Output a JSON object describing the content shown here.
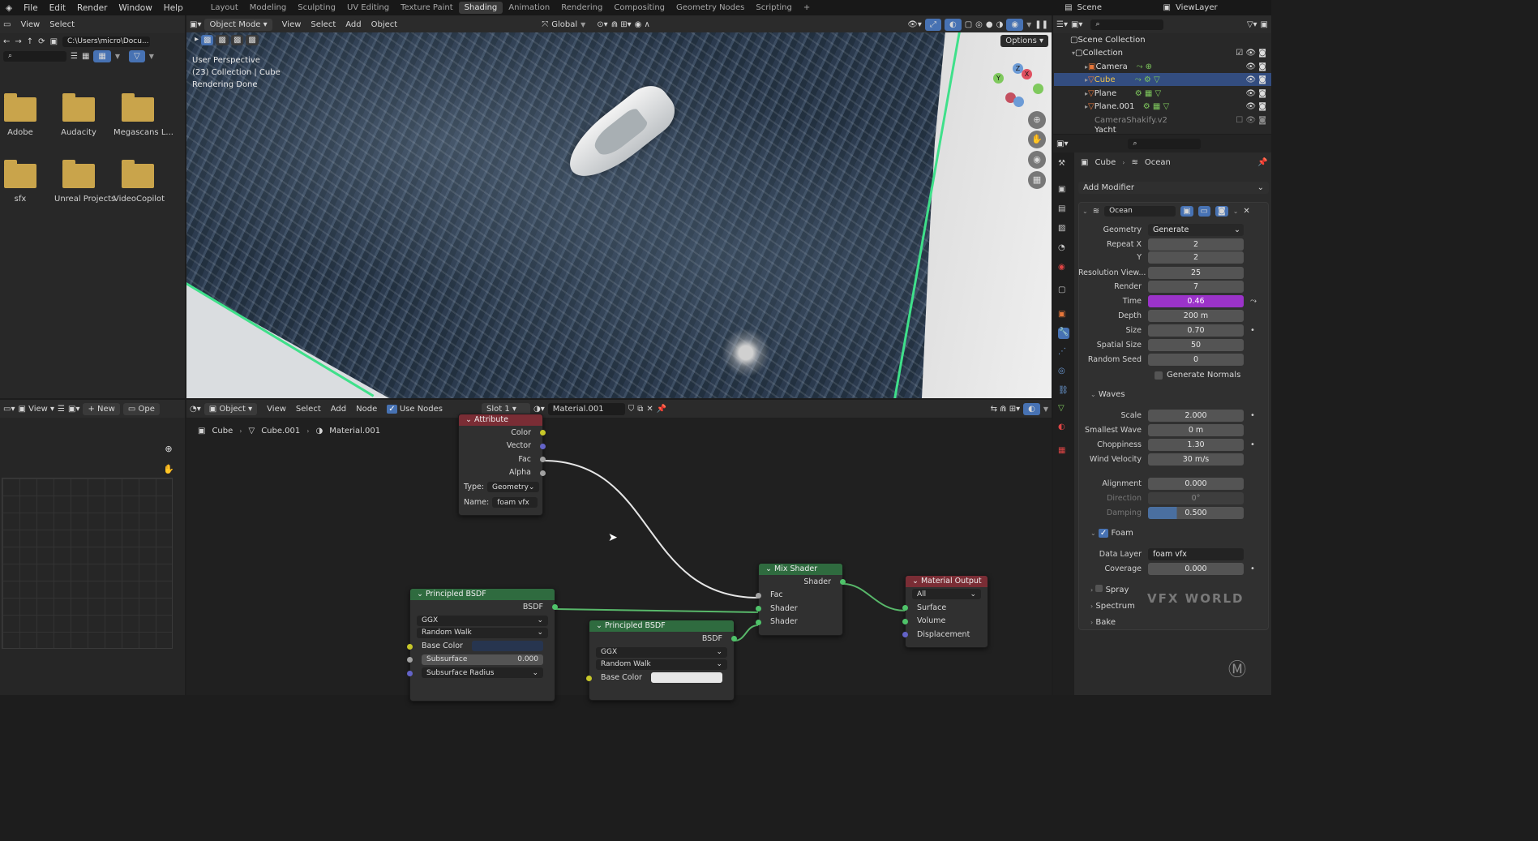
{
  "topbar": {
    "menus": [
      "File",
      "Edit",
      "Render",
      "Window",
      "Help"
    ],
    "workspaces": [
      "Layout",
      "Modeling",
      "Sculpting",
      "UV Editing",
      "Texture Paint",
      "Shading",
      "Animation",
      "Rendering",
      "Compositing",
      "Geometry Nodes",
      "Scripting"
    ],
    "active_workspace": "Shading",
    "scene": "Scene",
    "view_layer": "ViewLayer"
  },
  "file_browser": {
    "menus": [
      "View",
      "Select"
    ],
    "path": "C:\\Users\\micro\\Docu...",
    "folders": [
      "Adobe",
      "Audacity",
      "Megascans L...",
      "sfx",
      "Unreal Projects",
      "VideoCopilot"
    ]
  },
  "viewport": {
    "mode": "Object Mode",
    "menus": [
      "View",
      "Select",
      "Add",
      "Object"
    ],
    "transform": "Global",
    "options": "Options",
    "info": [
      "User Perspective",
      "(23) Collection | Cube",
      "Rendering Done"
    ]
  },
  "image_editor": {
    "view": "View",
    "new": "New",
    "open": "Ope"
  },
  "node_editor": {
    "type": "Object",
    "menus": [
      "View",
      "Select",
      "Add",
      "Node"
    ],
    "use_nodes": "Use Nodes",
    "slot": "Slot 1",
    "material": "Material.001",
    "breadcrumb": [
      "Cube",
      "Cube.001",
      "Material.001"
    ],
    "attribute": {
      "title": "Attribute",
      "outputs": [
        "Color",
        "Vector",
        "Fac",
        "Alpha"
      ],
      "type_label": "Type:",
      "type": "Geometry",
      "name_label": "Name:",
      "name": "foam vfx"
    },
    "bsdf1": {
      "title": "Principled BSDF",
      "out": "BSDF",
      "dist": "GGX",
      "sss": "Random Walk",
      "base_color": "Base Color",
      "subsurface": "Subsurface",
      "subsurface_val": "0.000",
      "radius": "Subsurface Radius"
    },
    "bsdf2": {
      "title": "Principled BSDF",
      "out": "BSDF",
      "dist": "GGX",
      "sss": "Random Walk",
      "base_color": "Base Color"
    },
    "mix": {
      "title": "Mix Shader",
      "out": "Shader",
      "in": [
        "Fac",
        "Shader",
        "Shader"
      ]
    },
    "output": {
      "title": "Material Output",
      "target": "All",
      "in": [
        "Surface",
        "Volume",
        "Displacement"
      ]
    }
  },
  "outliner": {
    "root": "Scene Collection",
    "collection": "Collection",
    "items": [
      "Camera",
      "Cube",
      "Plane",
      "Plane.001",
      "CameraShakify.v2",
      "Yacht"
    ]
  },
  "properties": {
    "breadcrumb": [
      "Cube",
      "Ocean"
    ],
    "add_modifier": "Add Modifier",
    "modifier": "Ocean",
    "rows": [
      {
        "label": "Geometry",
        "value": "Generate"
      },
      {
        "label": "Repeat X",
        "value": "2"
      },
      {
        "label": "Y",
        "value": "2"
      },
      {
        "label": "Resolution View...",
        "value": "25"
      },
      {
        "label": "Render",
        "value": "7"
      },
      {
        "label": "Time",
        "value": "0.46"
      },
      {
        "label": "Depth",
        "value": "200 m"
      },
      {
        "label": "Size",
        "value": "0.70"
      },
      {
        "label": "Spatial Size",
        "value": "50"
      },
      {
        "label": "Random Seed",
        "value": "0"
      }
    ],
    "generate_normals": "Generate Normals",
    "waves_title": "Waves",
    "waves": [
      {
        "label": "Scale",
        "value": "2.000"
      },
      {
        "label": "Smallest Wave",
        "value": "0 m"
      },
      {
        "label": "Choppiness",
        "value": "1.30"
      },
      {
        "label": "Wind Velocity",
        "value": "30 m/s"
      },
      {
        "label": "Alignment",
        "value": "0.000"
      },
      {
        "label": "Direction",
        "value": "0°"
      },
      {
        "label": "Damping",
        "value": "0.500"
      }
    ],
    "foam_title": "Foam",
    "foam": [
      {
        "label": "Data Layer",
        "value": "foam vfx"
      },
      {
        "label": "Coverage",
        "value": "0.000"
      }
    ],
    "sections": [
      "Spray",
      "Spectrum",
      "Bake"
    ],
    "watermark": "VFX WORLD"
  },
  "colors": {
    "accent_time": "#9b33c9",
    "node_shader": "#2f6b3f",
    "node_output": "#7a2d35",
    "selection_green": "#3fe08a"
  }
}
